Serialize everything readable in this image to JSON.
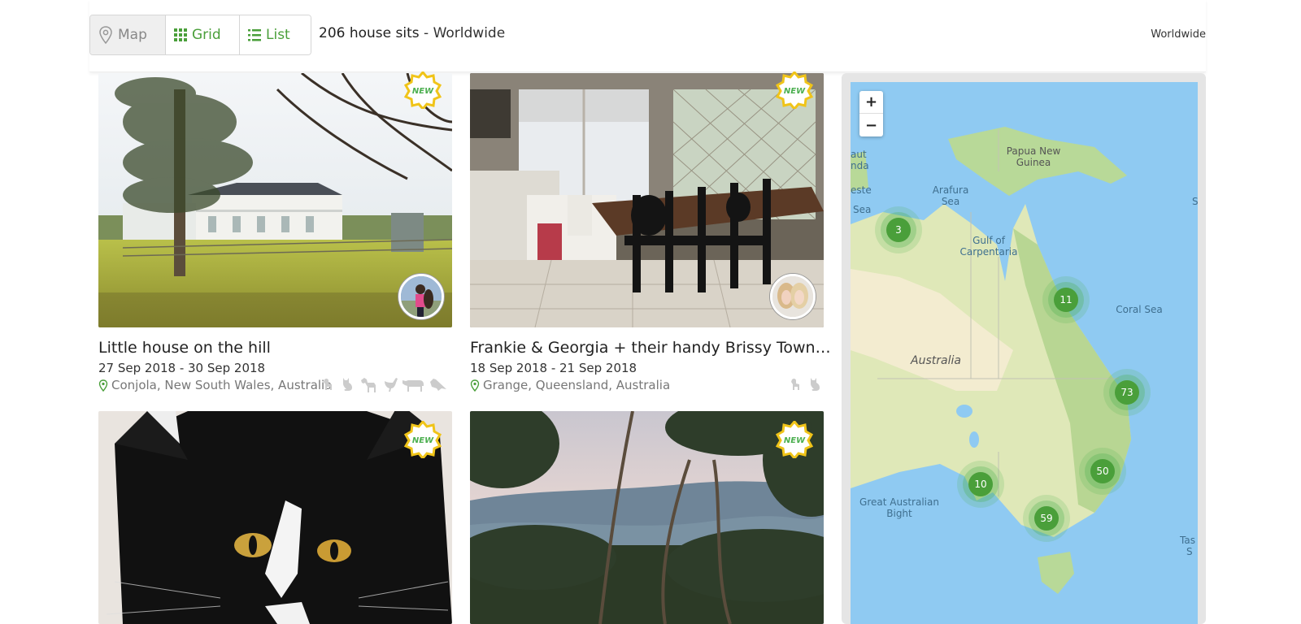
{
  "toolbar": {
    "map_label": "Map",
    "grid_label": "Grid",
    "list_label": "List",
    "count": "206 house sits",
    "separator": "-",
    "scope": "Worldwide",
    "right_region": "Worldwide"
  },
  "colors": {
    "accent": "#4a9f3a",
    "badge": "#f0c419",
    "cluster": "#4caf50"
  },
  "listings": [
    {
      "title": "Little house on the hill",
      "dates": "27 Sep 2018 - 30 Sep 2018",
      "location": "Conjola, New South Wales, Australia",
      "badge": "NEW",
      "pets": [
        "dog-icon",
        "cat-icon",
        "horse-icon",
        "poultry-icon",
        "livestock-icon",
        "bird-icon"
      ]
    },
    {
      "title": "Frankie & Georgia + their handy Brissy Town…",
      "dates": "18 Sep 2018 - 21 Sep 2018",
      "location": "Grange, Queensland, Australia",
      "badge": "NEW",
      "pets": [
        "dog-icon",
        "cat-icon"
      ]
    },
    {
      "badge": "NEW"
    },
    {
      "badge": "NEW"
    }
  ],
  "map": {
    "zoom_in": "+",
    "zoom_out": "−",
    "labels": {
      "papua": "Papua New Guinea",
      "arafura": "Arafura Sea",
      "carpentaria": "Gulf of Carpentaria",
      "coral": "Coral Sea",
      "australia": "Australia",
      "bight": "Great Australian Bight",
      "timor_a": "aut",
      "timor_b": "nda",
      "timor_c": "este",
      "timor_sea": "Sea",
      "tasman_a": "Tas",
      "tasman_b": "S",
      "s_edge": "S"
    },
    "clusters": [
      "3",
      "11",
      "73",
      "50",
      "10",
      "59"
    ]
  }
}
